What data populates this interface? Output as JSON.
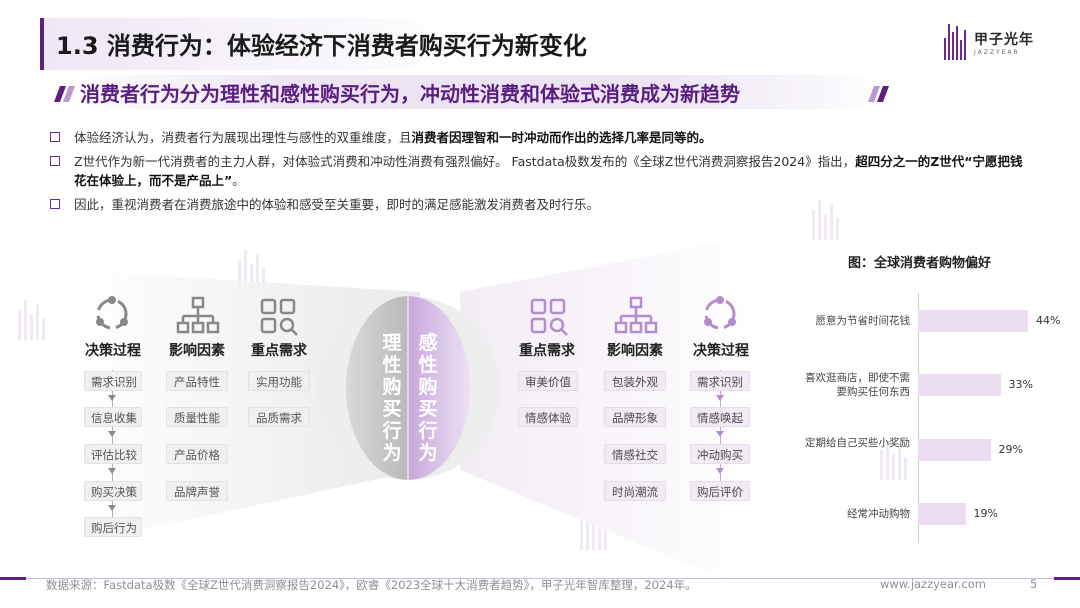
{
  "title": "1.3 消费行为：体验经济下消费者购买行为新变化",
  "logo": {
    "cn": "甲子光年",
    "en": "JAZZYEAR"
  },
  "subtitle": "消费者行为分为理性和感性购买行为，冲动性消费和体验式消费成为新趋势",
  "bullets": [
    {
      "pre": "体验经济认为，消费者行为展现出理性与感性的双重维度，且",
      "bold": "消费者因理智和一时冲动而作出的选择几率是同等的。",
      "post": ""
    },
    {
      "pre": "Z世代作为新一代消费者的主力人群，对体验式消费和冲动性消费有强烈偏好。 Fastdata极数发布的《全球Z世代消费洞察报告2024》指出，",
      "bold": "超四分之一的Z世代“宁愿把钱花在体验上，而不是产品上”",
      "post": "。"
    },
    {
      "pre": "因此，重视消费者在消费旅途中的体验和感受至关重要，即时的满足感能激发消费者及时行乐。",
      "bold": "",
      "post": ""
    }
  ],
  "left": {
    "columns": [
      {
        "head": "决策过程",
        "icon": "cycle-icon",
        "items": [
          "需求识别",
          "信息收集",
          "评估比较",
          "购买决策",
          "购后行为"
        ]
      },
      {
        "head": "影响因素",
        "icon": "hierarchy-icon",
        "items": [
          "产品特性",
          "质量性能",
          "产品价格",
          "品牌声誉"
        ]
      },
      {
        "head": "重点需求",
        "icon": "grid-search-icon",
        "items": [
          "实用功能",
          "品质需求"
        ]
      }
    ]
  },
  "center": {
    "rational": "理性购买行为",
    "emotional": "感性购买行为"
  },
  "right": {
    "columns": [
      {
        "head": "重点需求",
        "icon": "grid-search-icon",
        "items": [
          "审美价值",
          "情感体验"
        ]
      },
      {
        "head": "影响因素",
        "icon": "hierarchy-icon",
        "items": [
          "包装外观",
          "品牌形象",
          "情感社交",
          "时尚潮流"
        ]
      },
      {
        "head": "决策过程",
        "icon": "cycle-icon",
        "items": [
          "需求识别",
          "情感唤起",
          "冲动购买",
          "购后评价"
        ]
      }
    ]
  },
  "chart_data": {
    "type": "bar",
    "title": "图：全球消费者购物偏好",
    "categories": [
      "愿意为节省时间花钱",
      "喜欢逛商店，即使不需要购买任何东西",
      "定期给自己买些小奖励",
      "经常冲动购物"
    ],
    "values": [
      44,
      33,
      29,
      19
    ],
    "value_labels": [
      "44%",
      "33%",
      "29%",
      "19%"
    ],
    "orientation": "horizontal",
    "bar_color": "#ecdcef"
  },
  "footer": {
    "source": "数据来源：Fastdata极数《全球Z世代消费洞察报告2024》，欧睿《2023全球十大消费者趋势》，甲子光年智库整理，2024年。",
    "url": "www.jazzyear.com",
    "page": "5"
  },
  "colors": {
    "brand": "#5e1f83",
    "accent_light": "#ece3f3",
    "purple_mid": "#b99ad0"
  }
}
